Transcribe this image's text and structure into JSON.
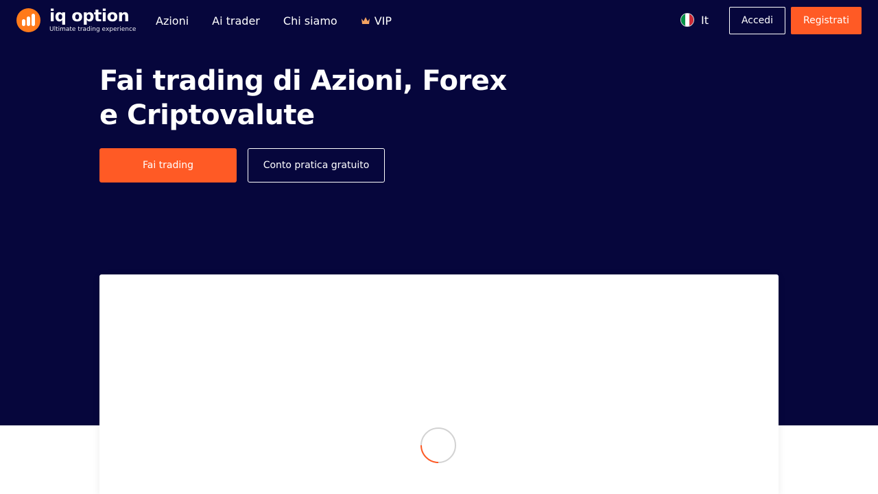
{
  "brand": {
    "name": "iq option",
    "tagline": "Ultimate trading experience",
    "accent": "#ff5a25",
    "background": "#06063c"
  },
  "nav": {
    "items": [
      {
        "label": "Azioni"
      },
      {
        "label": "Ai trader"
      },
      {
        "label": "Chi siamo"
      },
      {
        "label": "VIP",
        "icon": "crown-icon"
      }
    ]
  },
  "language": {
    "label": "It",
    "flag": "italy-flag-icon"
  },
  "header": {
    "login_label": "Accedi",
    "register_label": "Registrati"
  },
  "hero": {
    "title_line1": "Fai trading di Azioni, Forex",
    "title_line2": "e Criptovalute",
    "primary_cta": "Fai trading",
    "secondary_cta": "Conto pratica gratuito"
  },
  "content": {
    "state": "loading",
    "spinner_icon": "loading-spinner-icon"
  }
}
